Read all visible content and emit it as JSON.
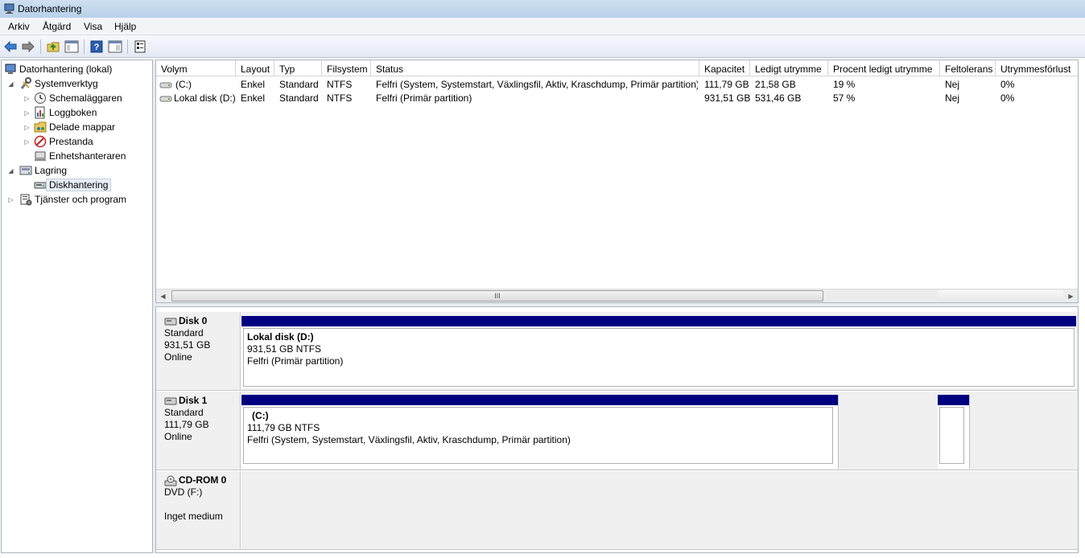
{
  "window": {
    "title": "Datorhantering"
  },
  "menu": [
    "Arkiv",
    "Åtgärd",
    "Visa",
    "Hjälp"
  ],
  "toolbar": {
    "icons": [
      "back-arrow-icon",
      "forward-arrow-icon",
      "folder-up-icon",
      "show-hide-tree-icon",
      "help-icon",
      "console-view-icon",
      "properties-icon"
    ]
  },
  "tree": {
    "root": "Datorhantering (lokal)",
    "systemtools": "Systemverktyg",
    "scheduler": "Schemaläggaren",
    "eventlog": "Loggboken",
    "shared": "Delade mappar",
    "performance": "Prestanda",
    "devmgr": "Enhetshanteraren",
    "storage": "Lagring",
    "diskmgmt": "Diskhantering",
    "services": "Tjänster och program"
  },
  "volumes": {
    "columns": [
      "Volym",
      "Layout",
      "Typ",
      "Filsystem",
      "Status",
      "Kapacitet",
      "Ledigt utrymme",
      "Procent ledigt utrymme",
      "Feltolerans",
      "Utrymmesförlust"
    ],
    "rows": [
      [
        "(C:)",
        "Enkel",
        "Standard",
        "NTFS",
        "Felfri (System, Systemstart, Växlingsfil, Aktiv, Kraschdump, Primär partition)",
        "111,79 GB",
        "21,58 GB",
        "19 %",
        "Nej",
        "0%"
      ],
      [
        "Lokal disk (D:)",
        "Enkel",
        "Standard",
        "NTFS",
        "Felfri (Primär partition)",
        "931,51 GB",
        "531,46 GB",
        "57 %",
        "Nej",
        "0%"
      ]
    ],
    "scroll_grip": "III"
  },
  "disks": {
    "disk0": {
      "name": "Disk 0",
      "type": "Standard",
      "size": "931,51 GB",
      "state": "Online",
      "part": {
        "name": "Lokal disk  (D:)",
        "size": "931,51 GB NTFS",
        "status": "Felfri (Primär partition)"
      }
    },
    "disk1": {
      "name": "Disk 1",
      "type": "Standard",
      "size": "111,79 GB",
      "state": "Online",
      "part": {
        "name": "(C:)",
        "size": "111,79 GB NTFS",
        "status": "Felfri (System, Systemstart, Växlingsfil, Aktiv, Kraschdump, Primär partition)"
      }
    },
    "cdrom0": {
      "name": "CD-ROM 0",
      "type": "DVD (F:)",
      "state": "Inget medium"
    }
  },
  "colors": {
    "partition_bar": "#000080",
    "disk_bg": "#f0f0f0"
  }
}
